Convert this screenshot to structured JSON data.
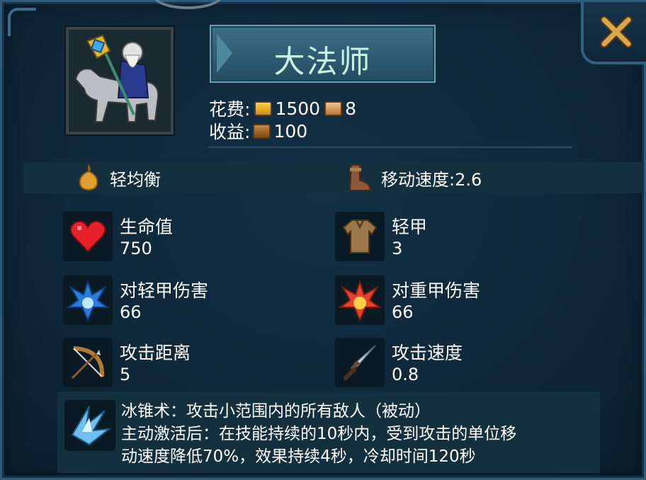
{
  "unit": {
    "name": "大法师",
    "cost_label": "花费:",
    "gold_cost": "1500",
    "population_cost": "8",
    "income_label": "收益:",
    "income": "100"
  },
  "traits": {
    "armor_type": "轻均衡",
    "move_speed": "移动速度:2.6"
  },
  "stats": [
    {
      "label": "生命值",
      "value": "750",
      "icon": "heart-icon"
    },
    {
      "label": "轻甲",
      "value": "3",
      "icon": "light-armor-icon"
    },
    {
      "label": "对轻甲伤害",
      "value": "66",
      "icon": "blue-burst-icon"
    },
    {
      "label": "对重甲伤害",
      "value": "66",
      "icon": "fire-burst-icon"
    },
    {
      "label": "攻击距离",
      "value": "5",
      "icon": "bow-icon"
    },
    {
      "label": "攻击速度",
      "value": "0.8",
      "icon": "dagger-icon"
    }
  ],
  "skill": {
    "line1": "冰锥术：攻击小范围内的所有敌人（被动）",
    "line2": "主动激活后：在技能持续的10秒内，受到攻击的单位移",
    "line3": "动速度降低70%，效果持续4秒，冷却时间120秒",
    "icon": "ice-shard-icon"
  },
  "colors": {
    "background": "#0f283a",
    "name_text": "#c8f3e2",
    "panel": "#14303f",
    "close_x": "#d9a84a"
  }
}
